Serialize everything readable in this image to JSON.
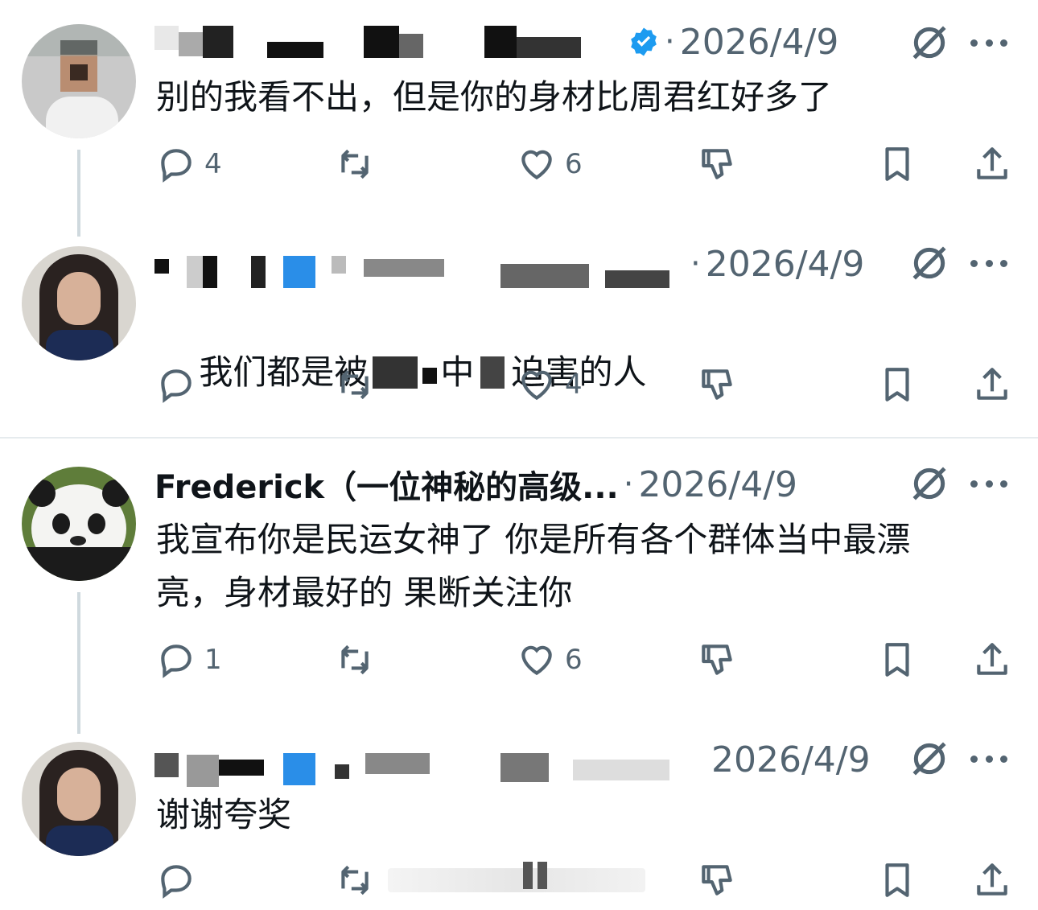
{
  "posts": [
    {
      "name": "",
      "date": "2026/4/9",
      "dot": "·",
      "text": "别的我看不出，但是你的身材比周君红好多了",
      "reply_count": "4",
      "like_count": "6",
      "verified": true
    },
    {
      "name": "",
      "date": "2026/4/9",
      "dot": "·",
      "text": "我们都是被",
      "text_part2": "中",
      "text_part3": "迫害的人",
      "reply_count": "",
      "like_count": "4"
    },
    {
      "name": "Frederick（一位神秘的高级...",
      "date": "2026/4/9",
      "dot": "·",
      "text": "我宣布你是民运女神了 你是所有各个群体当中最漂\n亮，身材最好的 果断关注你",
      "reply_count": "1",
      "like_count": "6"
    },
    {
      "name": "",
      "date": "2026/4/9",
      "dot": "",
      "text": "谢谢夸奖",
      "reply_count": "",
      "like_count": ""
    }
  ],
  "icons": {
    "reply": "reply-icon",
    "retweet": "retweet-icon",
    "like": "heart-icon",
    "dislike": "thumbs-down-icon",
    "bookmark": "bookmark-icon",
    "share": "share-icon",
    "grok": "grok-icon",
    "more": "more-icon"
  },
  "colors": {
    "text": "#0f1419",
    "muted": "#536471",
    "verified": "#1d9bf0",
    "thread_line": "#cfd9de"
  }
}
